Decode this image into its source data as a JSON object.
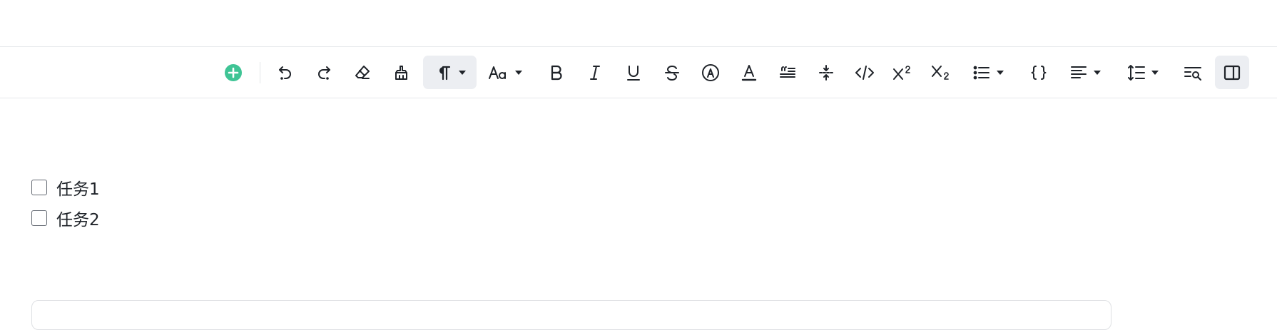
{
  "tasks": [
    {
      "label": "任务1",
      "checked": false
    },
    {
      "label": "任务2",
      "checked": false
    }
  ],
  "toolbar": {
    "insert": "plus-circle-icon",
    "insert_color": "#3fc495",
    "active_bg": "#eceef2",
    "buttons": [
      "undo",
      "redo",
      "clear-format",
      "format-painter",
      "paragraph",
      "font-size",
      "bold",
      "italic",
      "underline",
      "strikethrough",
      "highlight",
      "font-color",
      "quote",
      "collapse",
      "code",
      "superscript",
      "subscript",
      "list",
      "code-block",
      "align",
      "line-height",
      "find-replace",
      "side-panel"
    ]
  }
}
